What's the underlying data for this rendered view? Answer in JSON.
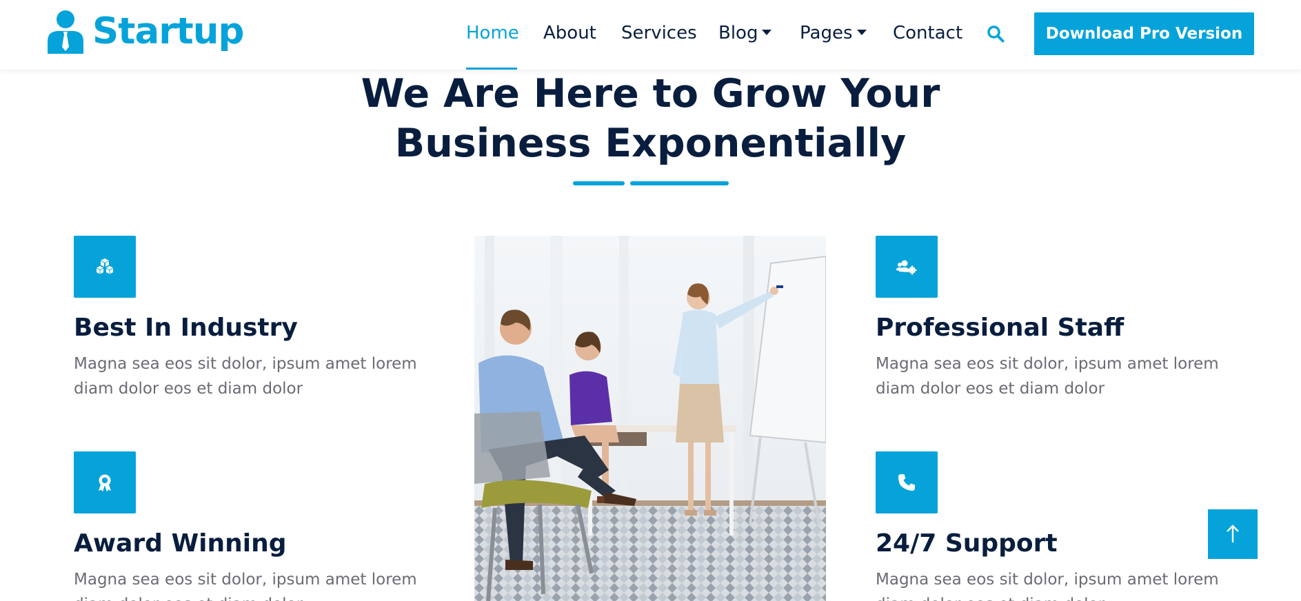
{
  "brand": {
    "name": "Startup",
    "logo_icon": "user-tie-icon",
    "color": "#06A3DA"
  },
  "nav": {
    "items": [
      {
        "label": "Home",
        "active": true
      },
      {
        "label": "About"
      },
      {
        "label": "Services"
      },
      {
        "label": "Blog",
        "dropdown": true
      },
      {
        "label": "Pages",
        "dropdown": true
      },
      {
        "label": "Contact"
      }
    ],
    "search_icon": "search-icon",
    "cta_label": "Download Pro Version"
  },
  "hero": {
    "title_line1": "We Are Here to Grow Your",
    "title_line2": "Business Exponentially"
  },
  "features": [
    {
      "title": "Best In Industry",
      "text": "Magna sea eos sit dolor, ipsum amet lorem diam dolor eos et diam dolor",
      "icon": "cubes-icon"
    },
    {
      "title": "Award Winning",
      "text": "Magna sea eos sit dolor, ipsum amet lorem diam dolor eos et diam dolor",
      "icon": "award-icon"
    },
    {
      "title": "Professional Staff",
      "text": "Magna sea eos sit dolor, ipsum amet lorem diam dolor eos et diam dolor",
      "icon": "users-cog-icon"
    },
    {
      "title": "24/7 Support",
      "text": "Magna sea eos sit dolor, ipsum amet lorem diam dolor eos et diam dolor",
      "icon": "phone-icon"
    }
  ],
  "photo": {
    "subject": "business-meeting-image"
  },
  "back_to_top_icon": "arrow-up-icon",
  "colors": {
    "primary": "#06A3DA",
    "dark": "#091E3E",
    "body_text": "#6B6A75"
  }
}
